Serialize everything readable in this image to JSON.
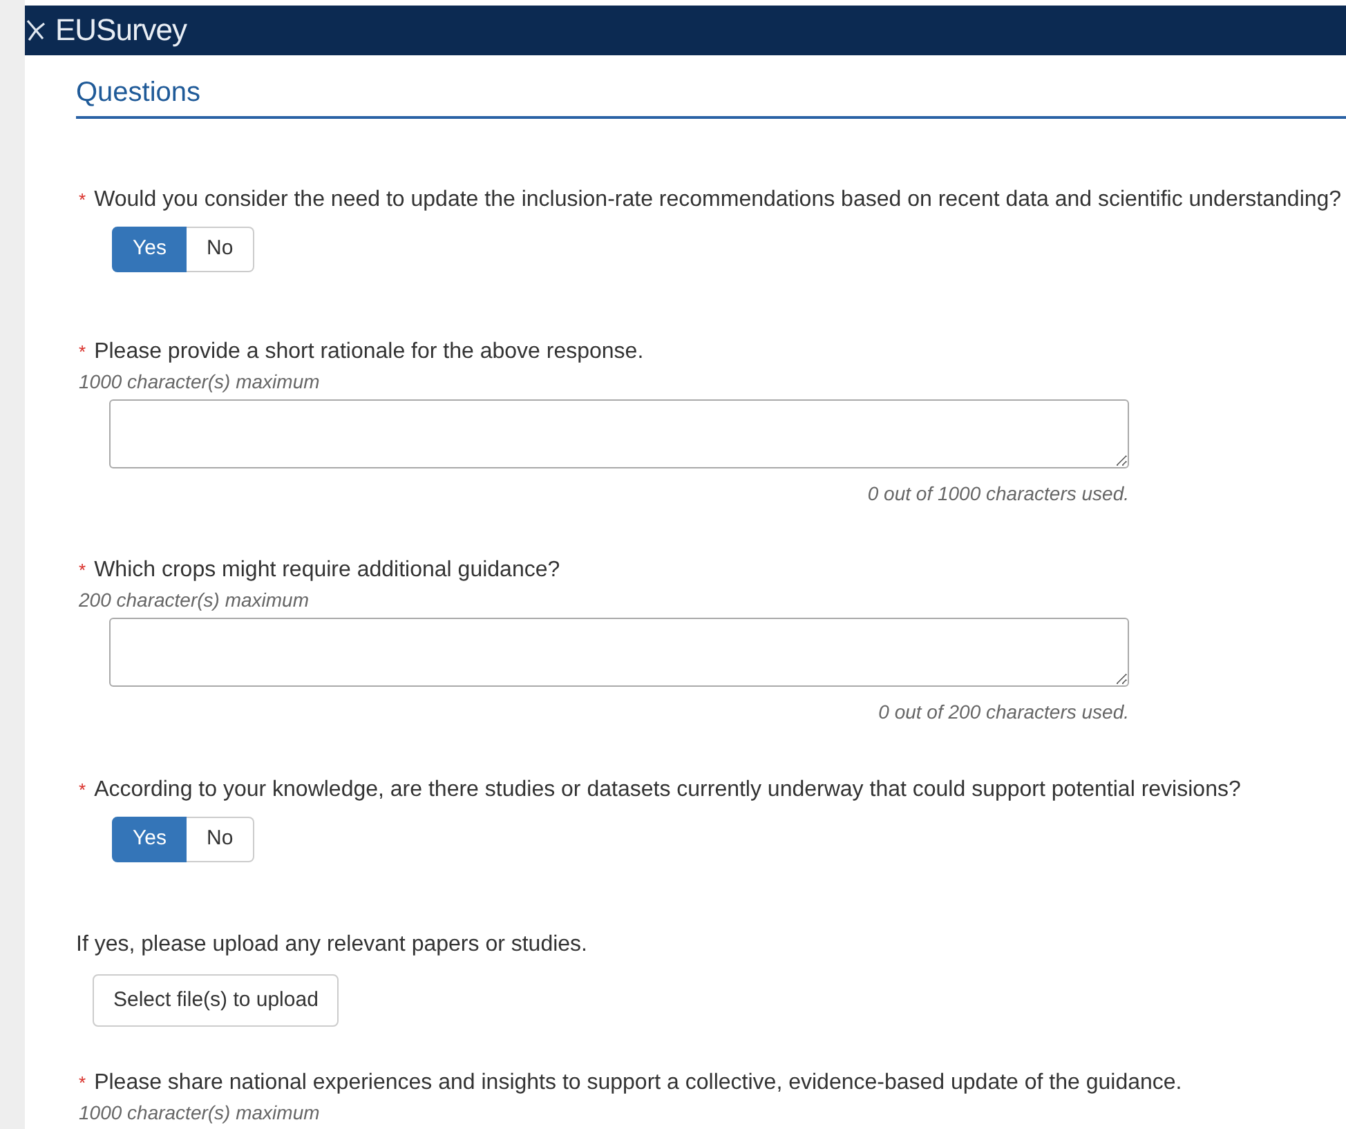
{
  "header": {
    "logo": "EUSurvey"
  },
  "section": {
    "title": "Questions"
  },
  "questions": [
    {
      "kind": "choice",
      "marker": "*",
      "label": "Would you consider the need to update the inclusion-rate recommendations based on recent data and scientific understanding?",
      "options": [
        {
          "label": "Yes",
          "selected": true
        },
        {
          "label": "No",
          "selected": false
        }
      ]
    },
    {
      "kind": "text",
      "marker": "*",
      "label": "Please provide a short rationale for the above response.",
      "hint": "1000 character(s) maximum",
      "counter": "0 out of 1000 characters used."
    },
    {
      "kind": "text",
      "marker": "*",
      "label": "Which crops might require additional guidance?",
      "hint": "200 character(s) maximum",
      "counter": "0 out of 200 characters used."
    },
    {
      "kind": "choice",
      "marker": "*",
      "label": "According to your knowledge, are there studies or datasets currently underway that could support potential revisions?",
      "options": [
        {
          "label": "Yes",
          "selected": true
        },
        {
          "label": "No",
          "selected": false
        }
      ]
    },
    {
      "kind": "upload",
      "label": "If yes, please upload any relevant papers or studies.",
      "button": "Select file(s) to upload"
    },
    {
      "kind": "text_cut",
      "marker": "*",
      "label": "Please share national experiences and insights to support a collective, evidence-based update of the guidance.",
      "hint": "1000 character(s) maximum"
    }
  ]
}
